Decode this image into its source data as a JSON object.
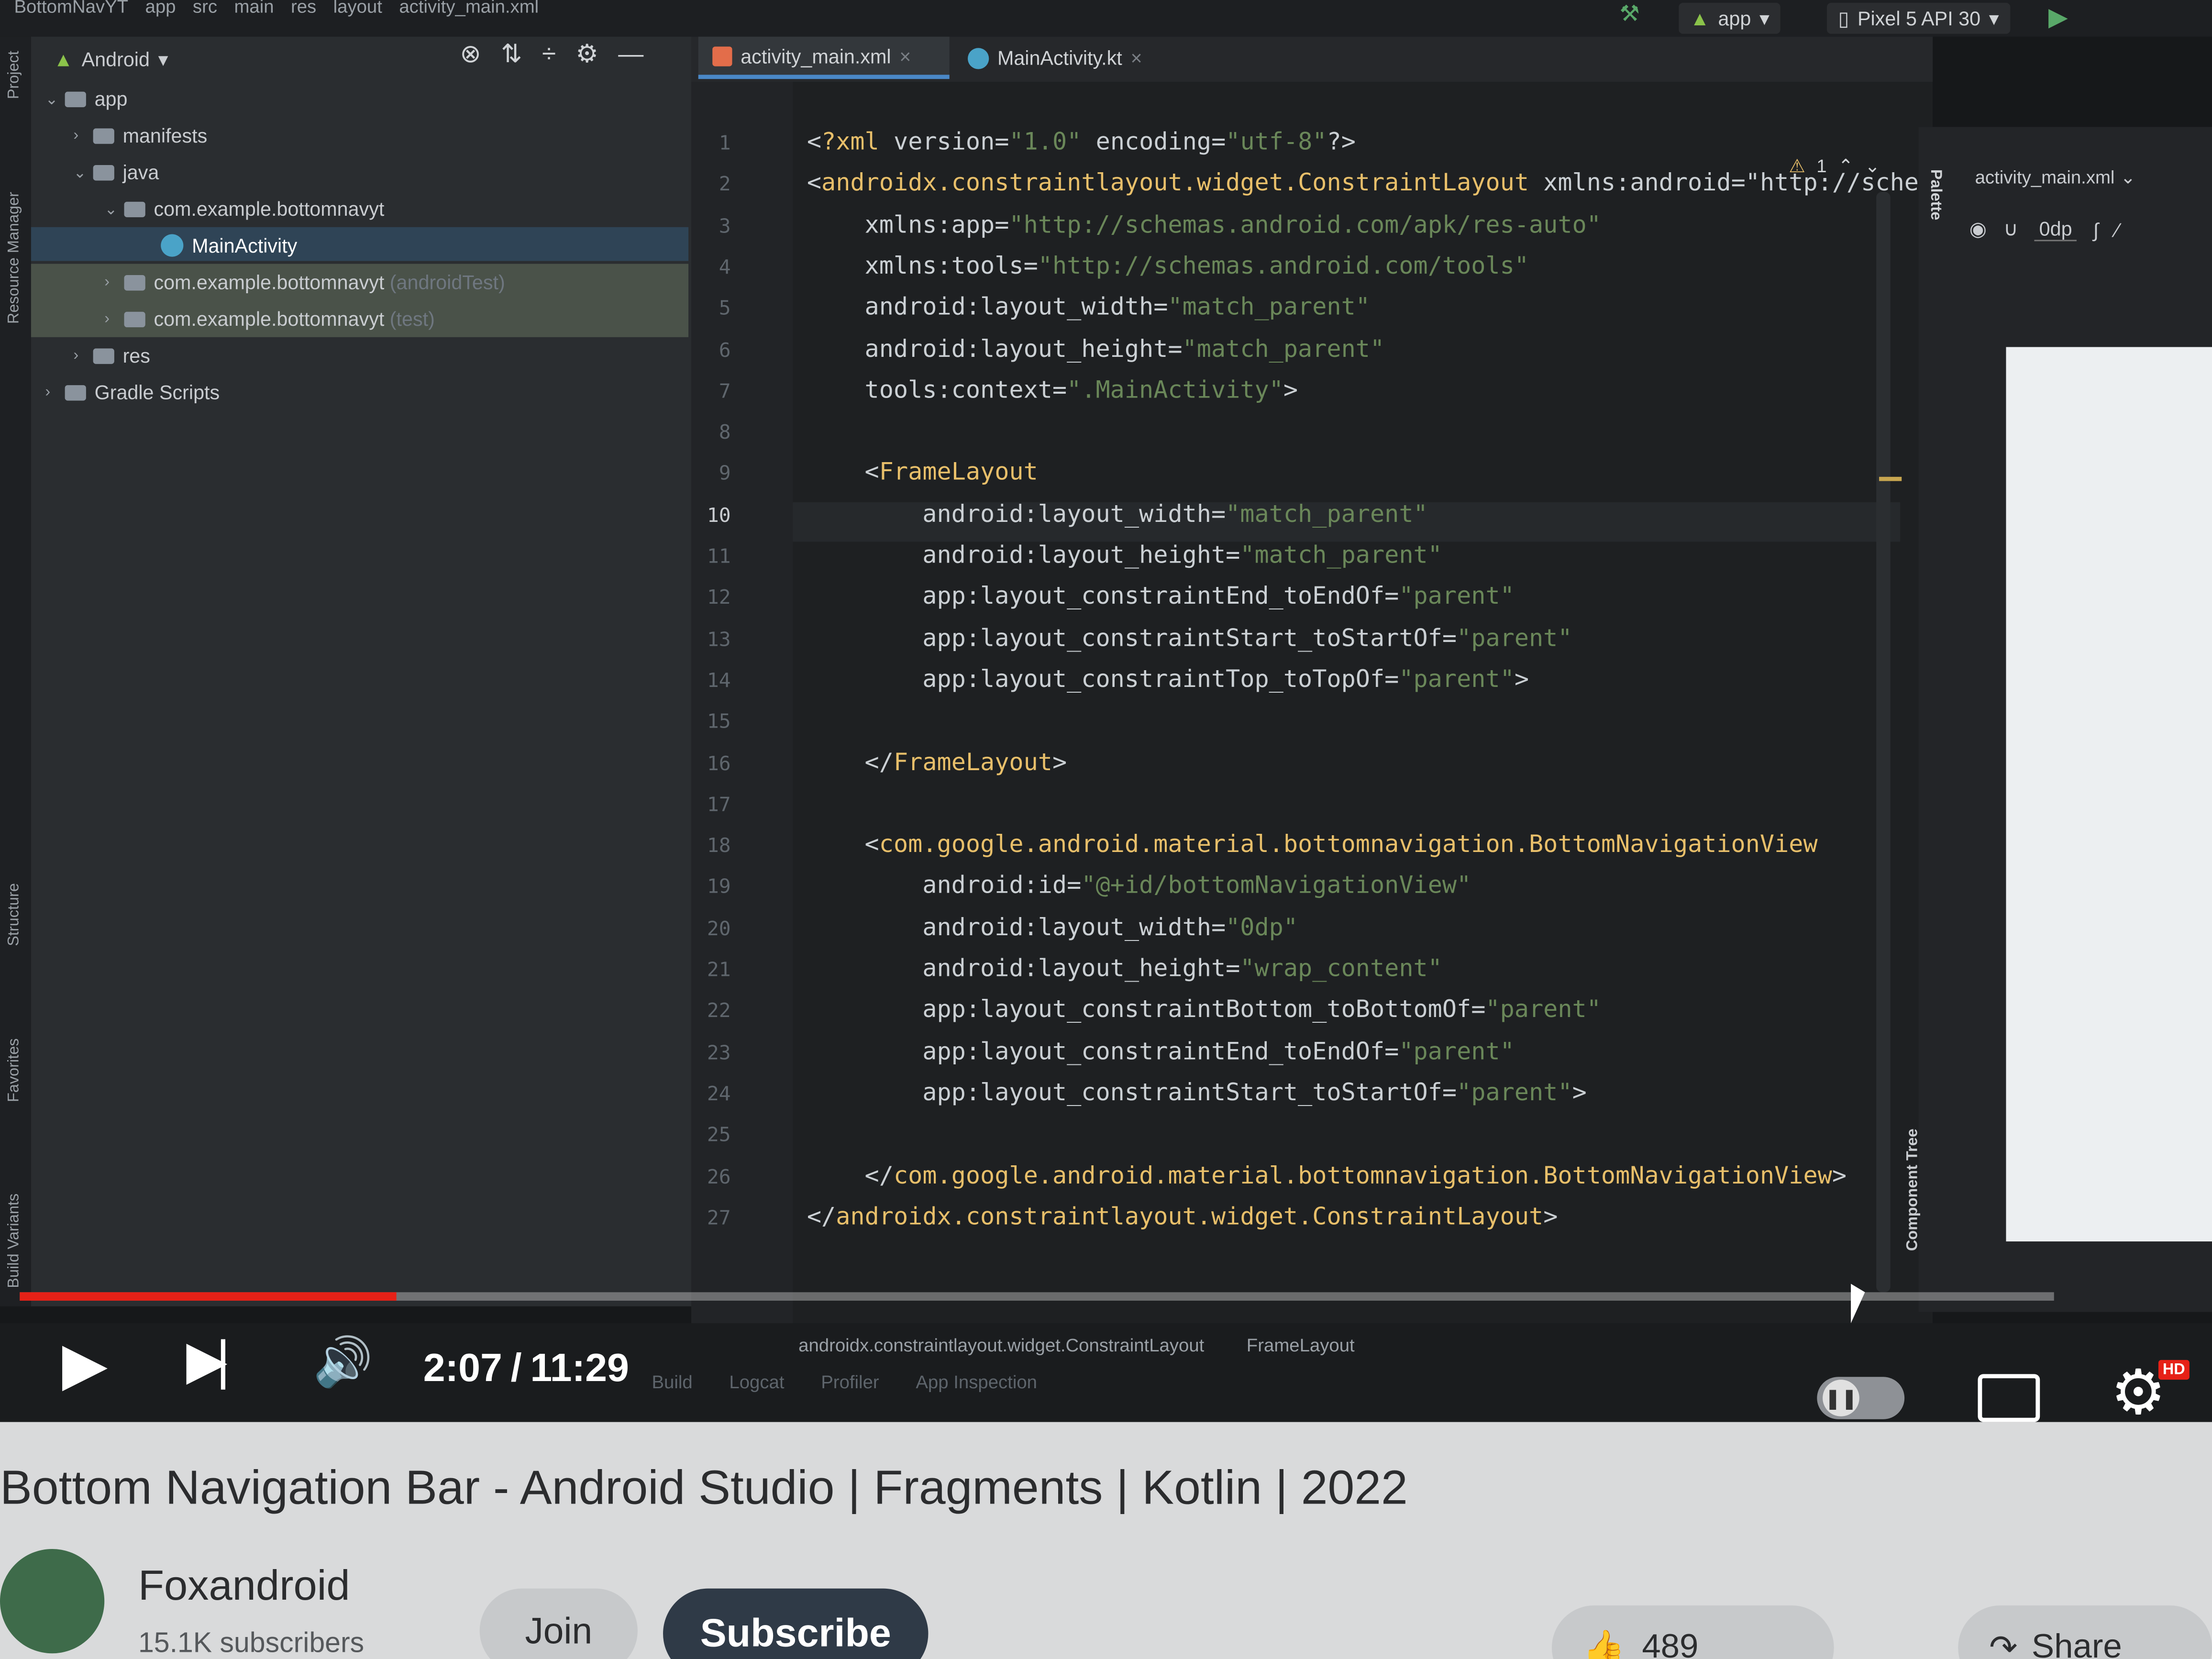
{
  "breadcrumb": [
    "BottomNavYT",
    "app",
    "src",
    "main",
    "res",
    "layout",
    "activity_main.xml"
  ],
  "toolbar": {
    "run_config": "app",
    "device": "Pixel 5 API 30"
  },
  "tool_windows": {
    "project": "Project",
    "resource_manager": "Resource Manager",
    "structure": "Structure",
    "favorites": "Favorites",
    "build_variants": "Build Variants"
  },
  "project_panel": {
    "view": "Android",
    "tree": [
      {
        "label": "app"
      },
      {
        "label": "manifests"
      },
      {
        "label": "java"
      },
      {
        "label": "com.example.bottomnavyt"
      },
      {
        "label": "MainActivity"
      },
      {
        "label": "com.example.bottomnavyt",
        "suffix": "(androidTest)"
      },
      {
        "label": "com.example.bottomnavyt",
        "suffix": "(test)"
      },
      {
        "label": "res"
      },
      {
        "label": "Gradle Scripts"
      }
    ]
  },
  "editor": {
    "tabs": [
      {
        "label": "activity_main.xml"
      },
      {
        "label": "MainActivity.kt"
      }
    ],
    "warnings": "1",
    "current_line": 10,
    "lines": [
      "<?xml version=\"1.0\" encoding=\"utf-8\"?>",
      "<androidx.constraintlayout.widget.ConstraintLayout xmlns:android=\"http://sche",
      "    xmlns:app=\"http://schemas.android.com/apk/res-auto\"",
      "    xmlns:tools=\"http://schemas.android.com/tools\"",
      "    android:layout_width=\"match_parent\"",
      "    android:layout_height=\"match_parent\"",
      "    tools:context=\".MainActivity\">",
      "",
      "    <FrameLayout",
      "        android:layout_width=\"match_parent\"",
      "        android:layout_height=\"match_parent\"",
      "        app:layout_constraintEnd_toEndOf=\"parent\"",
      "        app:layout_constraintStart_toStartOf=\"parent\"",
      "        app:layout_constraintTop_toTopOf=\"parent\">",
      "",
      "    </FrameLayout>",
      "",
      "    <com.google.android.material.bottomnavigation.BottomNavigationView",
      "        android:id=\"@+id/bottomNavigationView\"",
      "        android:layout_width=\"0dp\"",
      "        android:layout_height=\"wrap_content\"",
      "        app:layout_constraintBottom_toBottomOf=\"parent\"",
      "        app:layout_constraintEnd_toEndOf=\"parent\"",
      "        app:layout_constraintStart_toStartOf=\"parent\">",
      "",
      "    </com.google.android.material.bottomnavigation.BottomNavigationView>",
      "</androidx.constraintlayout.widget.ConstraintLayout>"
    ]
  },
  "design_panel": {
    "palette": "Palette",
    "file": "activity_main.xml",
    "margin": "0dp",
    "component_tree": "Component Tree"
  },
  "ide_status": {
    "breadcrumb": [
      "androidx.constraintlayout.widget.ConstraintLayout",
      "FrameLayout"
    ],
    "tools": [
      "Build",
      "Logcat",
      "Profiler",
      "App Inspection"
    ]
  },
  "player": {
    "time_current": "2:07",
    "time_separator": "/",
    "time_total": "11:29",
    "progress": 0.185,
    "hd_badge": "HD"
  },
  "video": {
    "title": "Bottom Navigation Bar - Android Studio | Fragments | Kotlin | 2022",
    "channel": "Foxandroid",
    "subscribers": "15.1K subscribers",
    "join_label": "Join",
    "subscribe_label": "Subscribe",
    "likes": "489",
    "share_label": "Share"
  },
  "colors": {
    "progress_played": "#e62117",
    "subscribe_bg": "#2f3a47",
    "xml_tag": "#e8bf6a",
    "xml_value": "#6a8759"
  }
}
